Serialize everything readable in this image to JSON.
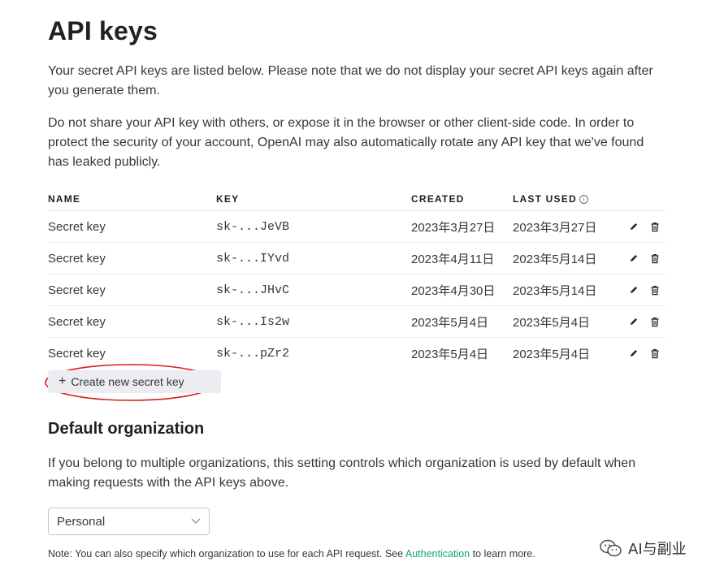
{
  "title": "API keys",
  "intro": {
    "p1": "Your secret API keys are listed below. Please note that we do not display your secret API keys again after you generate them.",
    "p2": "Do not share your API key with others, or expose it in the browser or other client-side code. In order to protect the security of your account, OpenAI may also automatically rotate any API key that we've found has leaked publicly."
  },
  "table": {
    "headers": {
      "name": "NAME",
      "key": "KEY",
      "created": "CREATED",
      "last_used": "LAST USED"
    },
    "rows": [
      {
        "name": "Secret key",
        "key": "sk-...JeVB",
        "created": "2023年3月27日",
        "last_used": "2023年3月27日"
      },
      {
        "name": "Secret key",
        "key": "sk-...IYvd",
        "created": "2023年4月11日",
        "last_used": "2023年5月14日"
      },
      {
        "name": "Secret key",
        "key": "sk-...JHvC",
        "created": "2023年4月30日",
        "last_used": "2023年5月14日"
      },
      {
        "name": "Secret key",
        "key": "sk-...Is2w",
        "created": "2023年5月4日",
        "last_used": "2023年5月4日"
      },
      {
        "name": "Secret key",
        "key": "sk-...pZr2",
        "created": "2023年5月4日",
        "last_used": "2023年5月4日"
      }
    ],
    "info_icon": "info-icon",
    "edit_icon": "pencil-icon",
    "delete_icon": "trash-icon"
  },
  "create_button": {
    "plus": "+",
    "label": "Create new secret key"
  },
  "highlight_color": "#d81e1e",
  "org": {
    "heading": "Default organization",
    "description": "If you belong to multiple organizations, this setting controls which organization is used by default when making requests with the API keys above.",
    "select_value": "Personal"
  },
  "note": {
    "before": "Note: You can also specify which organization to use for each API request. See",
    "link": "Authentication",
    "after": "to learn more."
  },
  "accent_color": "#10a37f",
  "watermark": {
    "text": "AI与副业",
    "icon": "wechat-icon"
  }
}
